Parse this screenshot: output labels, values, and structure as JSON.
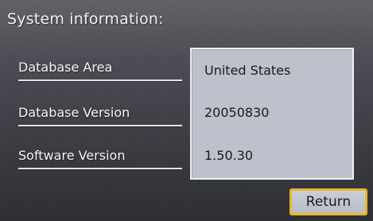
{
  "screen": {
    "title": "System information:"
  },
  "rows": [
    {
      "label": "Database Area",
      "value": "United States"
    },
    {
      "label": "Database Version",
      "value": "20050830"
    },
    {
      "label": "Software Version",
      "value": "1.50.30"
    }
  ],
  "actions": {
    "return_label": "Return"
  },
  "colors": {
    "accent_border": "#e8b928",
    "panel_bg": "#bcc1cc"
  }
}
